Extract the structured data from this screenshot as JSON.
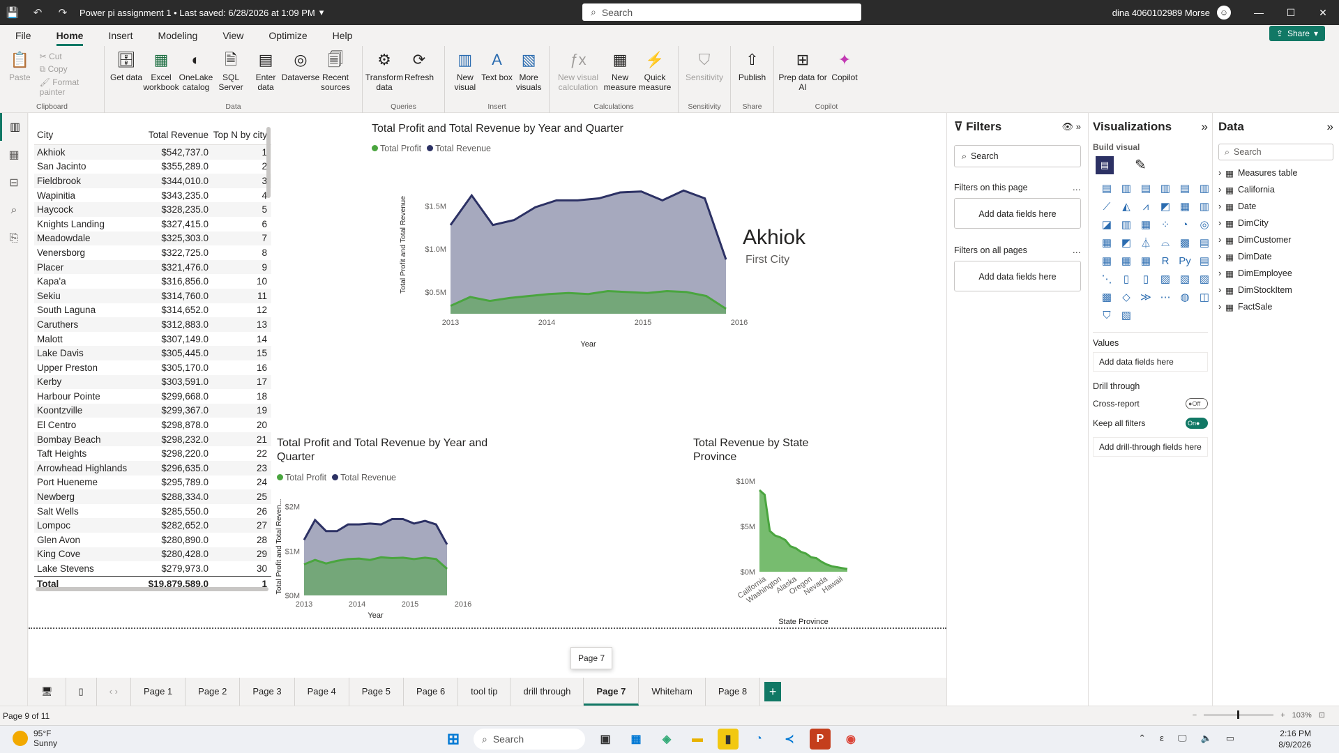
{
  "titlebar": {
    "title": "Power pi assignment 1 • Last saved: 6/28/2026 at 1:09 PM",
    "search_placeholder": "Search",
    "user": "dina 4060102989 Morse",
    "controls": [
      "—",
      "☐",
      "✕"
    ]
  },
  "menu": {
    "items": [
      "File",
      "Home",
      "Insert",
      "Modeling",
      "View",
      "Optimize",
      "Help"
    ],
    "active": "Home",
    "share": "Share"
  },
  "ribbon": {
    "clipboard": {
      "label": "Clipboard",
      "paste": "Paste",
      "cut": "Cut",
      "copy": "Copy",
      "format_painter": "Format painter"
    },
    "data": {
      "label": "Data",
      "buttons": [
        "Get data",
        "Excel workbook",
        "OneLake catalog",
        "SQL Server",
        "Enter data",
        "Dataverse",
        "Recent sources"
      ]
    },
    "queries": {
      "label": "Queries",
      "buttons": [
        "Transform data",
        "Refresh"
      ]
    },
    "insert": {
      "label": "Insert",
      "buttons": [
        "New visual",
        "Text box",
        "More visuals"
      ]
    },
    "calculations": {
      "label": "Calculations",
      "buttons": [
        "New visual calculation",
        "New measure",
        "Quick measure"
      ]
    },
    "sensitivity": {
      "label": "Sensitivity",
      "buttons": [
        "Sensitivity"
      ]
    },
    "share": {
      "label": "Share",
      "buttons": [
        "Publish"
      ]
    },
    "copilot": {
      "label": "Copilot",
      "buttons": [
        "Prep data for AI",
        "Copilot"
      ]
    }
  },
  "table": {
    "headers": [
      "City",
      "Total Revenue",
      "Top N by city"
    ],
    "rows": [
      [
        "Akhiok",
        "$542,737.0",
        "1"
      ],
      [
        "San Jacinto",
        "$355,289.0",
        "2"
      ],
      [
        "Fieldbrook",
        "$344,010.0",
        "3"
      ],
      [
        "Wapinitia",
        "$343,235.0",
        "4"
      ],
      [
        "Haycock",
        "$328,235.0",
        "5"
      ],
      [
        "Knights Landing",
        "$327,415.0",
        "6"
      ],
      [
        "Meadowdale",
        "$325,303.0",
        "7"
      ],
      [
        "Venersborg",
        "$322,725.0",
        "8"
      ],
      [
        "Placer",
        "$321,476.0",
        "9"
      ],
      [
        "Kapa'a",
        "$316,856.0",
        "10"
      ],
      [
        "Sekiu",
        "$314,760.0",
        "11"
      ],
      [
        "South Laguna",
        "$314,652.0",
        "12"
      ],
      [
        "Caruthers",
        "$312,883.0",
        "13"
      ],
      [
        "Malott",
        "$307,149.0",
        "14"
      ],
      [
        "Lake Davis",
        "$305,445.0",
        "15"
      ],
      [
        "Upper Preston",
        "$305,170.0",
        "16"
      ],
      [
        "Kerby",
        "$303,591.0",
        "17"
      ],
      [
        "Harbour Pointe",
        "$299,668.0",
        "18"
      ],
      [
        "Koontzville",
        "$299,367.0",
        "19"
      ],
      [
        "El Centro",
        "$298,878.0",
        "20"
      ],
      [
        "Bombay Beach",
        "$298,232.0",
        "21"
      ],
      [
        "Taft Heights",
        "$298,220.0",
        "22"
      ],
      [
        "Arrowhead Highlands",
        "$296,635.0",
        "23"
      ],
      [
        "Port Hueneme",
        "$295,789.0",
        "24"
      ],
      [
        "Newberg",
        "$288,334.0",
        "25"
      ],
      [
        "Salt Wells",
        "$285,550.0",
        "26"
      ],
      [
        "Lompoc",
        "$282,652.0",
        "27"
      ],
      [
        "Glen Avon",
        "$280,890.0",
        "28"
      ],
      [
        "King Cove",
        "$280,428.0",
        "29"
      ],
      [
        "Lake Stevens",
        "$279,973.0",
        "30"
      ]
    ],
    "total": [
      "Total",
      "$19,879,589.0",
      "1"
    ]
  },
  "card": {
    "value": "Akhiok",
    "label": "First City"
  },
  "chart_data": [
    {
      "type": "area",
      "title": "Total Profit and Total Revenue by Year and Quarter",
      "xlabel": "Year",
      "ylabel": "Total Profit and Total Revenue",
      "x_ticks": [
        "2013",
        "2014",
        "2015",
        "2016"
      ],
      "y_ticks": [
        "$0.5M",
        "$1.0M",
        "$1.5M"
      ],
      "ylim": [
        0.4,
        1.8
      ],
      "series": [
        {
          "name": "Total Profit",
          "color": "#4aa53f",
          "values": [
            0.48,
            0.57,
            0.53,
            0.56,
            0.58,
            0.6,
            0.61,
            0.6,
            0.63,
            0.62,
            0.61,
            0.63,
            0.62,
            0.58,
            0.45
          ]
        },
        {
          "name": "Total Revenue",
          "color": "#2c3164",
          "values": [
            1.3,
            1.6,
            1.3,
            1.35,
            1.48,
            1.55,
            1.55,
            1.57,
            1.63,
            1.64,
            1.55,
            1.65,
            1.57,
            0.95
          ]
        }
      ]
    },
    {
      "type": "area",
      "title": "Total Profit and Total Revenue by Year and Quarter",
      "xlabel": "Year",
      "ylabel": "Total Profit and Total Reven...",
      "x_ticks": [
        "2013",
        "2014",
        "2015",
        "2016"
      ],
      "y_ticks": [
        "$0M",
        "$1M",
        "$2M"
      ],
      "ylim": [
        0,
        2.2
      ],
      "series": [
        {
          "name": "Total Profit",
          "color": "#4aa53f",
          "values": [
            0.7,
            0.8,
            0.72,
            0.78,
            0.82,
            0.83,
            0.8,
            0.86,
            0.84,
            0.85,
            0.82,
            0.85,
            0.82,
            0.6
          ]
        },
        {
          "name": "Total Revenue",
          "color": "#2c3164",
          "values": [
            1.25,
            1.7,
            1.45,
            1.45,
            1.6,
            1.6,
            1.62,
            1.6,
            1.72,
            1.72,
            1.62,
            1.68,
            1.6,
            1.15
          ]
        }
      ]
    },
    {
      "type": "area",
      "title": "Total Revenue by State Province",
      "xlabel": "State Province",
      "ylabel": "",
      "x_ticks": [
        "California",
        "Washington",
        "Alaska",
        "Oregon",
        "Nevada",
        "Hawaii"
      ],
      "y_ticks": [
        "$0M",
        "$5M",
        "$10M"
      ],
      "ylim": [
        0,
        10
      ],
      "series": [
        {
          "name": "Total Revenue",
          "color": "#4aa53f",
          "values": [
            9.0,
            8.5,
            4.5,
            4.0,
            3.8,
            3.5,
            2.8,
            2.6,
            2.2,
            2.0,
            1.6,
            1.5,
            1.1,
            0.8,
            0.6,
            0.5,
            0.4,
            0.3
          ]
        }
      ]
    }
  ],
  "page_tabs": [
    "Page 1",
    "Page 2",
    "Page 3",
    "Page 4",
    "Page 5",
    "Page 6",
    "tool tip",
    "drill through",
    "Page 7",
    "Whiteham",
    "Page 8"
  ],
  "active_tab": "Page 7",
  "tooltip": "Page 7",
  "status": {
    "page": "Page 9 of 11",
    "zoom": "103%"
  },
  "filters": {
    "title": "Filters",
    "search": "Search",
    "on_page": "Filters on this page",
    "add_fields": "Add data fields here",
    "all_pages": "Filters on all pages"
  },
  "viz": {
    "title": "Visualizations",
    "build": "Build visual",
    "values": "Values",
    "add_fields": "Add data fields here",
    "drill": "Drill through",
    "cross": "Cross-report",
    "cross_state": "Off",
    "keep": "Keep all filters",
    "keep_state": "On",
    "add_drill": "Add drill-through fields here"
  },
  "data_pane": {
    "title": "Data",
    "search": "Search",
    "tables": [
      "Measures table",
      "California",
      "Date",
      "DimCity",
      "DimCustomer",
      "DimDate",
      "DimEmployee",
      "DimStockItem",
      "FactSale"
    ]
  },
  "taskbar": {
    "temp": "95°F",
    "weather": "Sunny",
    "search": "Search",
    "time": "2:16 PM",
    "date": "8/9/2026"
  }
}
